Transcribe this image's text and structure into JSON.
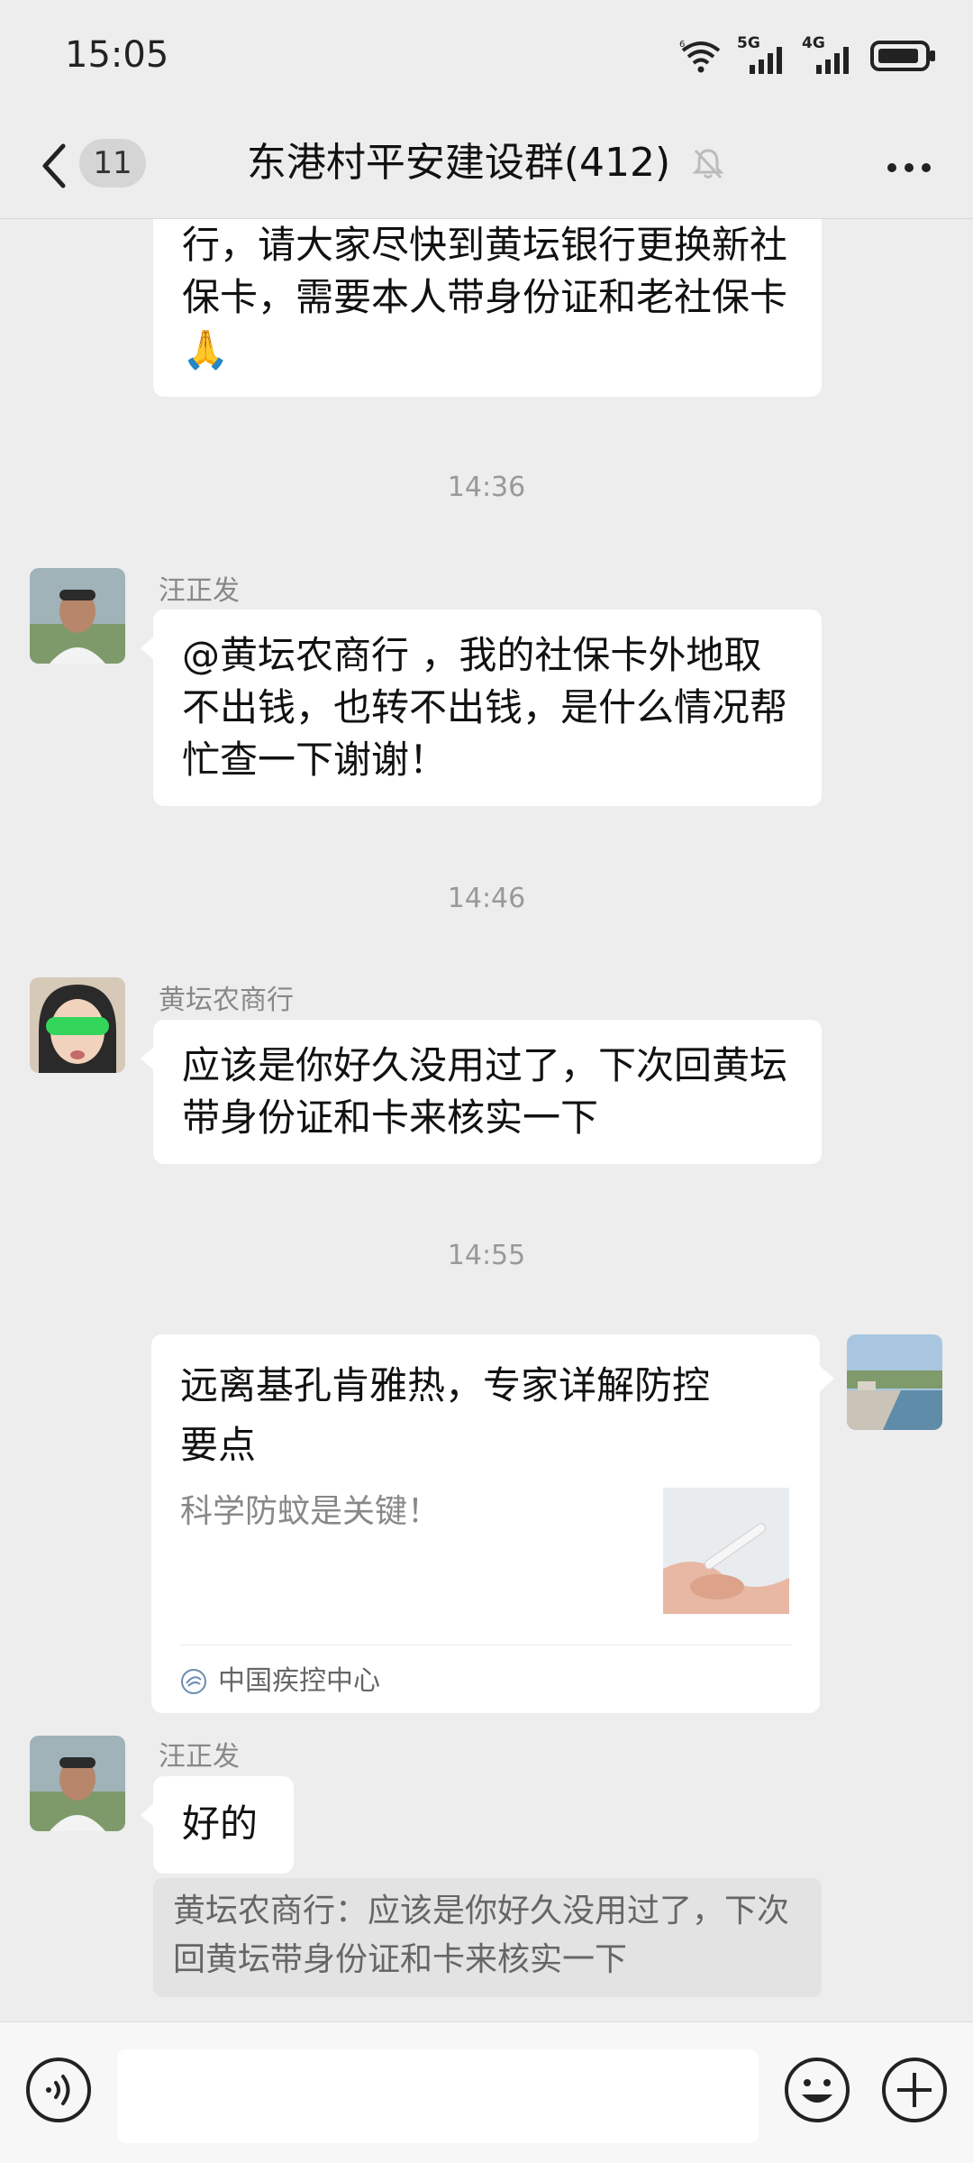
{
  "status_bar": {
    "time": "15:05",
    "network_1": "5G",
    "network_2": "4G"
  },
  "header": {
    "back_count": "11",
    "title": "东港村平安建设群(412)"
  },
  "messages": {
    "m1": {
      "text": "行，请大家尽快到黄坛银行更换新社保卡，需要本人带身份证和老社保卡🙏"
    },
    "t1": "14:36",
    "m2": {
      "sender": "汪正发",
      "text": "@黄坛农商行 ，我的社保卡外地取不出钱，也转不出钱，是什么情况帮忙查一下谢谢！"
    },
    "t2": "14:46",
    "m3": {
      "sender": "黄坛农商行",
      "text": "应该是你好久没用过了，下次回黄坛带身份证和卡来核实一下"
    },
    "t3": "14:55",
    "m4": {
      "title": "远离基孔肯雅热，专家详解防控要点",
      "desc": "科学防蚊是关键！",
      "source": "中国疾控中心"
    },
    "m5": {
      "sender": "汪正发",
      "text": "好的",
      "quote": "黄坛农商行：应该是你好久没用过了，下次回黄坛带身份证和卡来核实一下"
    }
  },
  "input": {
    "placeholder": ""
  },
  "colors": {
    "background": "#ededed",
    "bubble": "#ffffff",
    "timestamp": "#999999",
    "quote_bg": "#e3e3e3"
  },
  "icons": [
    "wifi-icon",
    "signal-icon",
    "battery-icon",
    "back-arrow-icon",
    "mute-bell-icon",
    "more-icon",
    "voice-icon",
    "emoji-icon",
    "plus-icon",
    "source-logo-icon"
  ]
}
